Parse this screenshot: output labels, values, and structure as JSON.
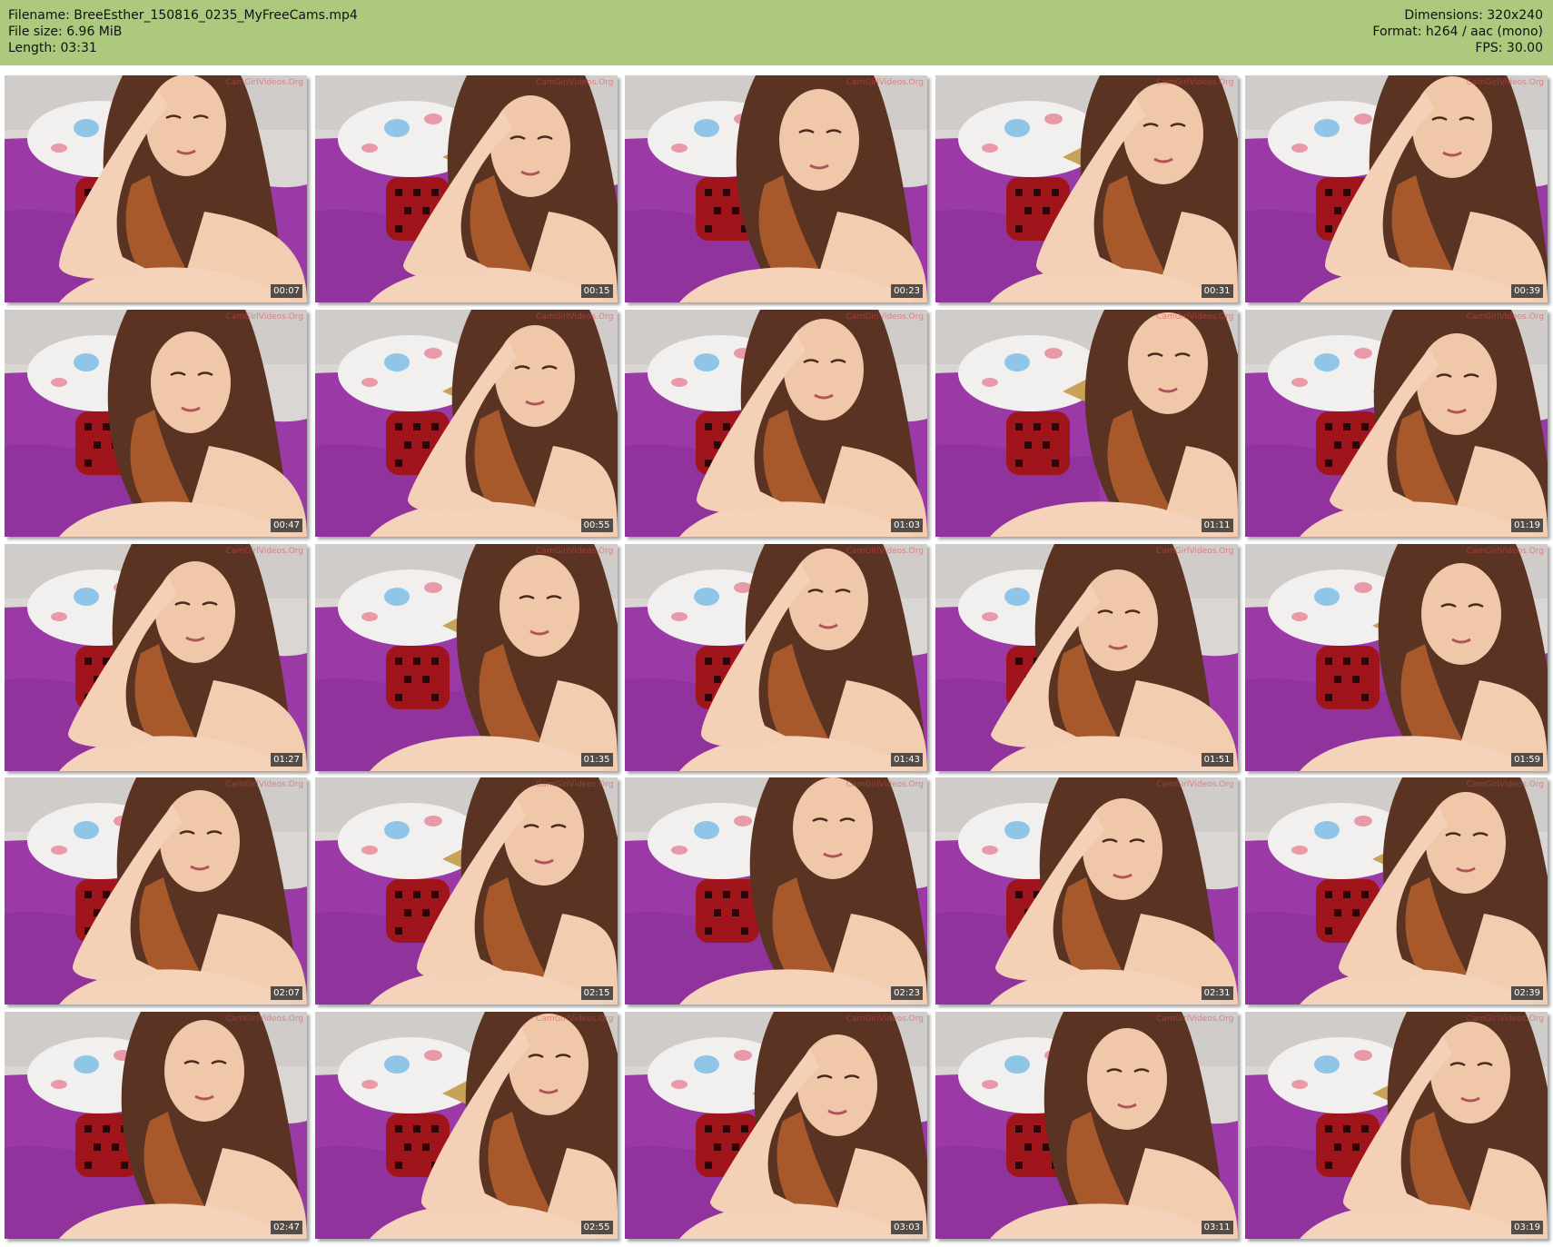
{
  "header": {
    "filename": "Filename: BreeEsther_150816_0235_MyFreeCams.mp4",
    "filesize": "File size: 6.96 MiB",
    "length": "Length: 03:31",
    "dimensions": "Dimensions: 320x240",
    "format": "Format: h264 / aac (mono)",
    "fps": "FPS: 30.00"
  },
  "watermark": "CamGirlVideos.Org",
  "thumbnails": [
    {
      "time": "00:07"
    },
    {
      "time": "00:15"
    },
    {
      "time": "00:23"
    },
    {
      "time": "00:31"
    },
    {
      "time": "00:39"
    },
    {
      "time": "00:47"
    },
    {
      "time": "00:55"
    },
    {
      "time": "01:03"
    },
    {
      "time": "01:11"
    },
    {
      "time": "01:19"
    },
    {
      "time": "01:27"
    },
    {
      "time": "01:35"
    },
    {
      "time": "01:43"
    },
    {
      "time": "01:51"
    },
    {
      "time": "01:59"
    },
    {
      "time": "02:07"
    },
    {
      "time": "02:15"
    },
    {
      "time": "02:23"
    },
    {
      "time": "02:31"
    },
    {
      "time": "02:39"
    },
    {
      "time": "02:47"
    },
    {
      "time": "02:55"
    },
    {
      "time": "03:03"
    },
    {
      "time": "03:11"
    },
    {
      "time": "03:19"
    }
  ],
  "colors": {
    "header_bg": "#adc97e",
    "bedsheet": "#9b3aa6",
    "wall": "#d9d6d4",
    "pillow": "#f2f0ee",
    "red_cushion": "#a0141c",
    "skin": "#f0c7a8",
    "hair": "#5a3322"
  }
}
